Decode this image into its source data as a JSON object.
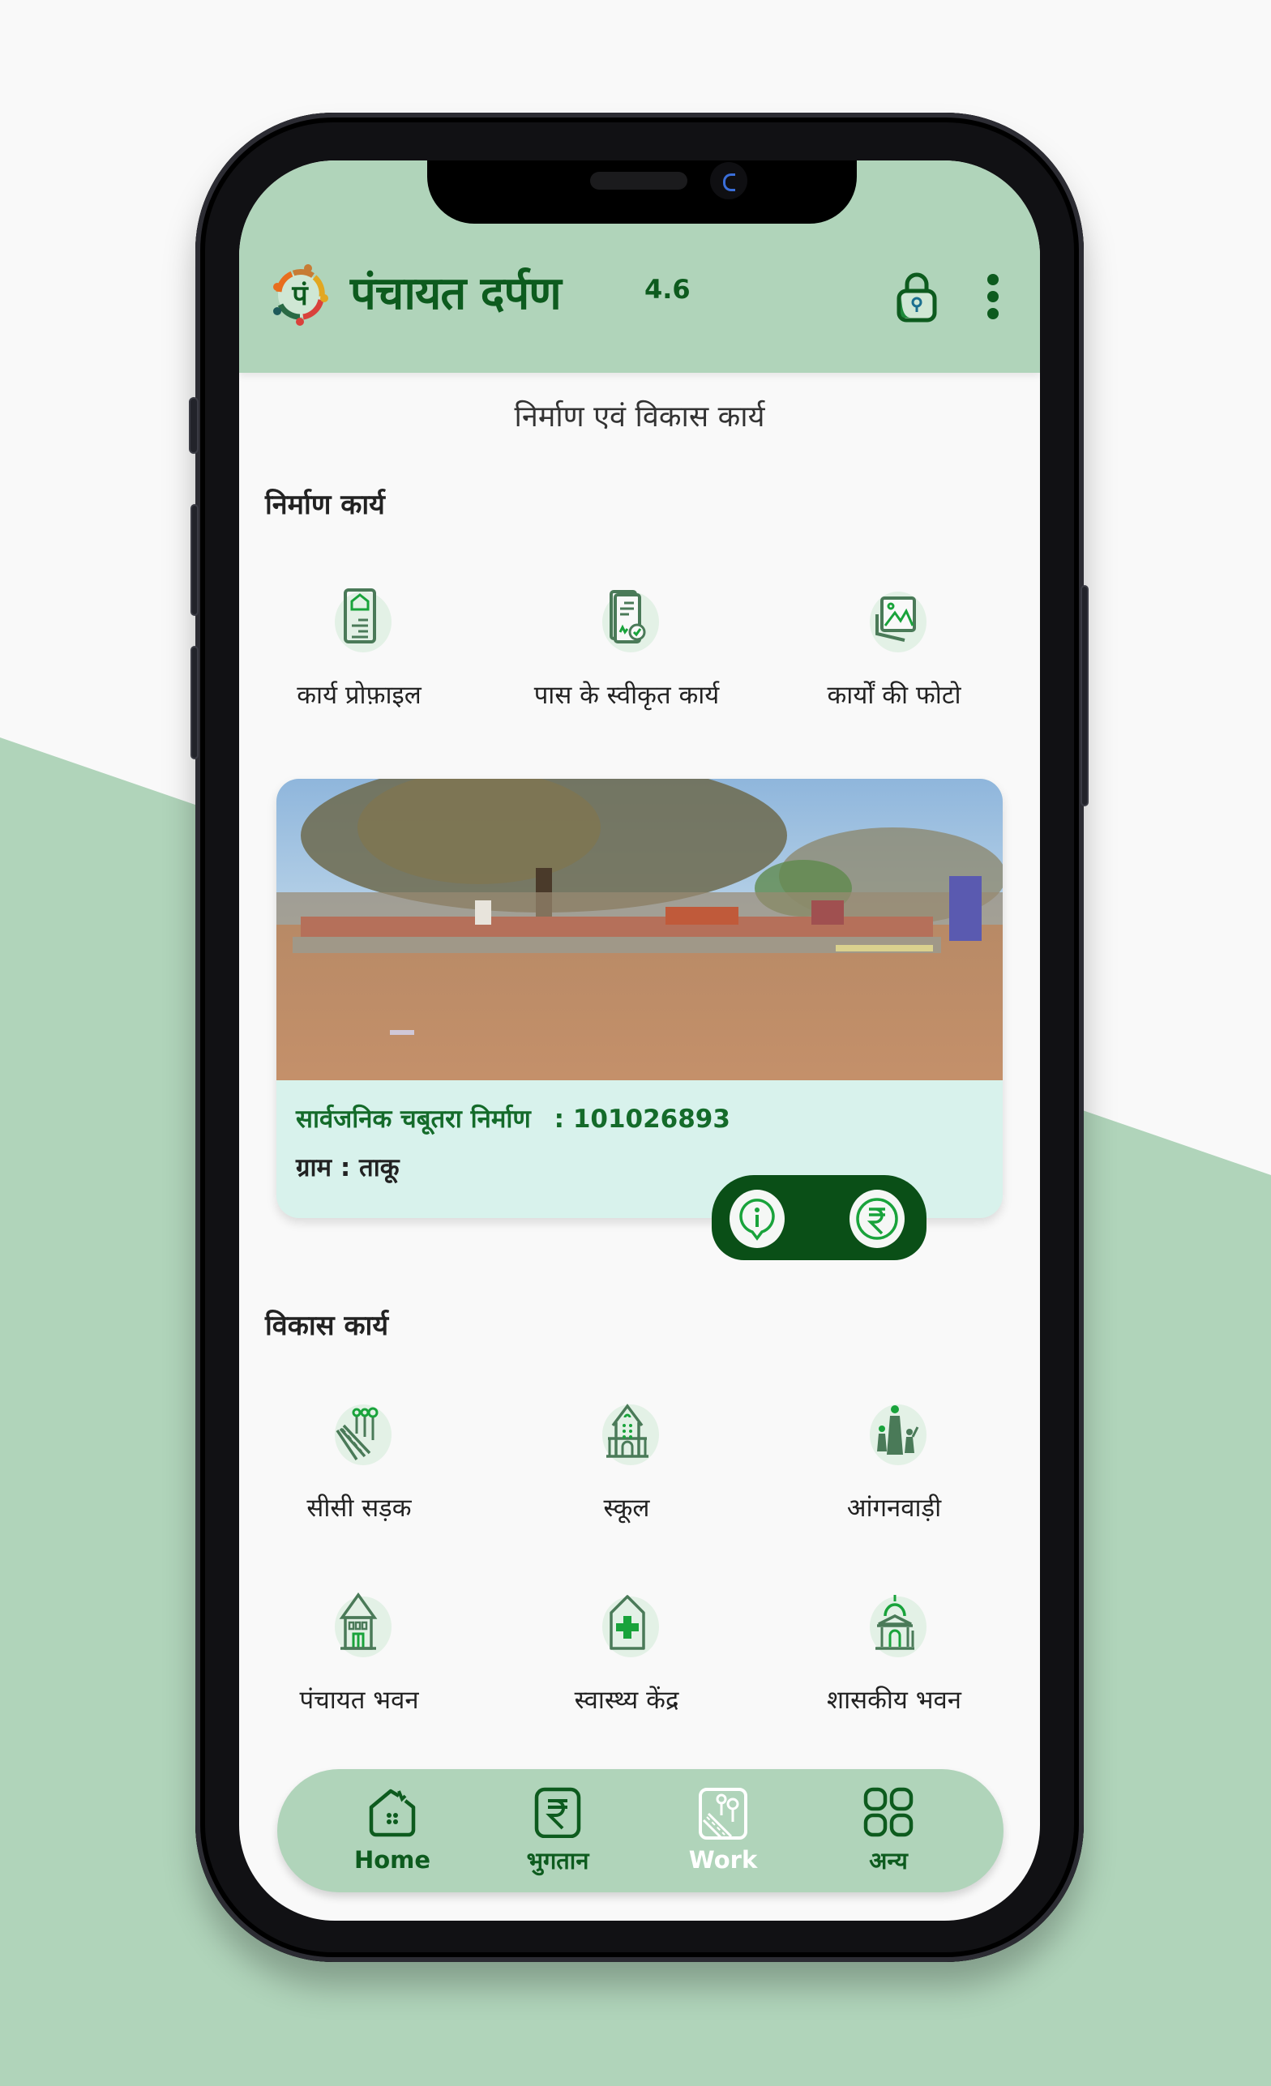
{
  "app": {
    "title": "पंचायत दर्पण",
    "version": "4.6",
    "icons": {
      "logo": "panchayat-logo",
      "lock": "lock-icon",
      "menu": "more-vert-icon"
    }
  },
  "page": {
    "title": "निर्माण एवं विकास कार्य"
  },
  "construction": {
    "section_title": "निर्माण कार्य",
    "items": [
      {
        "label": "कार्य प्रोफ़ाइल",
        "icon": "work-profile-icon"
      },
      {
        "label": "पास के स्वीकृत कार्य",
        "icon": "approved-works-icon"
      },
      {
        "label": "कार्यों की फोटो",
        "icon": "work-photos-icon"
      }
    ]
  },
  "featured_work": {
    "name": "सार्वजनिक चबूतरा निर्माण",
    "id_text": ": 101026893",
    "village": "ग्राम : ताकू",
    "actions": [
      {
        "icon": "info-icon"
      },
      {
        "icon": "rupee-icon"
      }
    ]
  },
  "development": {
    "section_title": "विकास कार्य",
    "items": [
      {
        "label": "सीसी सड़क",
        "icon": "cc-road-icon"
      },
      {
        "label": "स्कूल",
        "icon": "school-icon"
      },
      {
        "label": "आंगनवाड़ी",
        "icon": "anganwadi-icon"
      },
      {
        "label": "पंचायत भवन",
        "icon": "panchayat-bhawan-icon"
      },
      {
        "label": "स्वास्थ्य केंद्र",
        "icon": "health-centre-icon"
      },
      {
        "label": "शासकीय भवन",
        "icon": "government-building-icon"
      }
    ]
  },
  "bottom_nav": {
    "active": "Work",
    "items": [
      {
        "label": "Home",
        "icon": "home-icon"
      },
      {
        "label": "भुगतान",
        "icon": "payment-icon"
      },
      {
        "label": "Work",
        "icon": "work-icon"
      },
      {
        "label": "अन्य",
        "icon": "more-grid-icon"
      }
    ]
  },
  "colors": {
    "header_bg": "#b0d4ba",
    "brand_dark": "#0d5b1e",
    "card_bg": "#d8f2ec",
    "pill_bg": "#0a4f17",
    "accent_green": "#19a33b"
  }
}
